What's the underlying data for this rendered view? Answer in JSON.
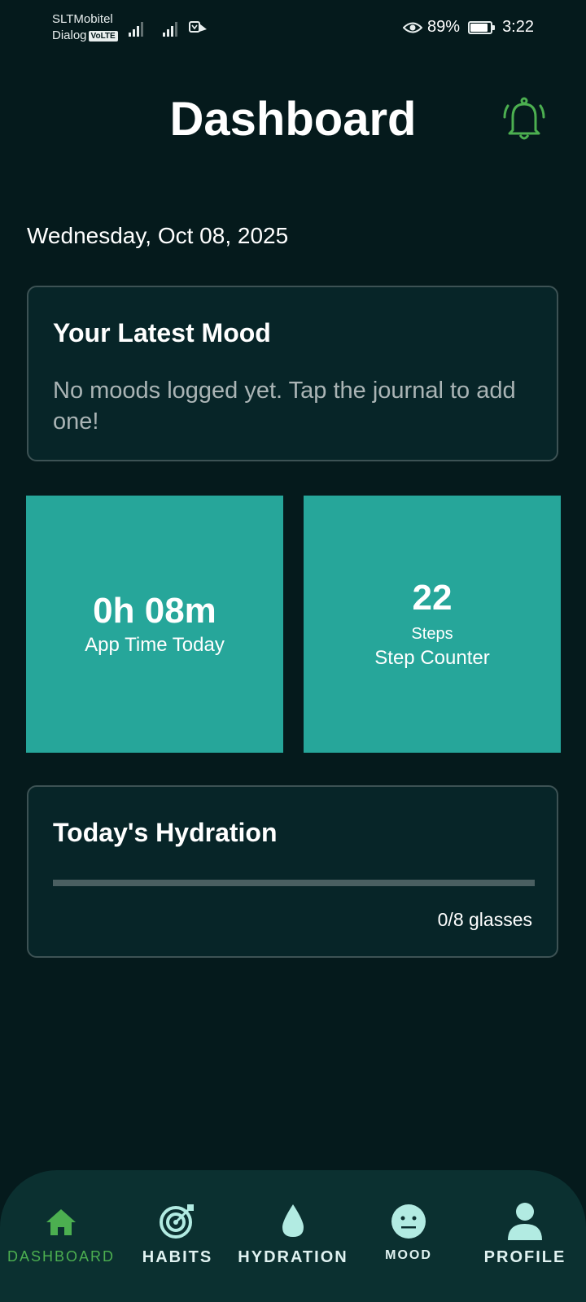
{
  "status_bar": {
    "carrier_1": "SLTMobitel",
    "carrier_2": "Dialog",
    "volte_badge": "VoLTE",
    "battery_percent": "89%",
    "battery_level": 0.89,
    "time": "3:22"
  },
  "header": {
    "title": "Dashboard",
    "bell_icon": "bell-icon"
  },
  "date": "Wednesday, Oct 08, 2025",
  "mood_card": {
    "title": "Your Latest Mood",
    "message": "No moods logged yet. Tap the journal to add one!"
  },
  "tiles": {
    "app_time": {
      "value": "0h 08m",
      "label": "App Time Today"
    },
    "steps": {
      "value": "22",
      "unit": "Steps",
      "label": "Step Counter"
    }
  },
  "hydration_card": {
    "title": "Today's Hydration",
    "progress_fraction": 0,
    "glasses_text": "0/8 glasses"
  },
  "bottom_nav": {
    "items": [
      {
        "label": "DASHBOARD",
        "icon": "home-icon",
        "active": true
      },
      {
        "label": "HABITS",
        "icon": "target-icon",
        "active": false
      },
      {
        "label": "HYDRATION",
        "icon": "water-drop-icon",
        "active": false
      },
      {
        "label": "MOOD",
        "icon": "neutral-face-icon",
        "active": false
      },
      {
        "label": "PROFILE",
        "icon": "person-icon",
        "active": false
      }
    ]
  },
  "colors": {
    "background": "#051a1c",
    "card": "#072528",
    "tile": "#26a69a",
    "active_nav": "#4caf50",
    "bell": "#4caf50"
  }
}
